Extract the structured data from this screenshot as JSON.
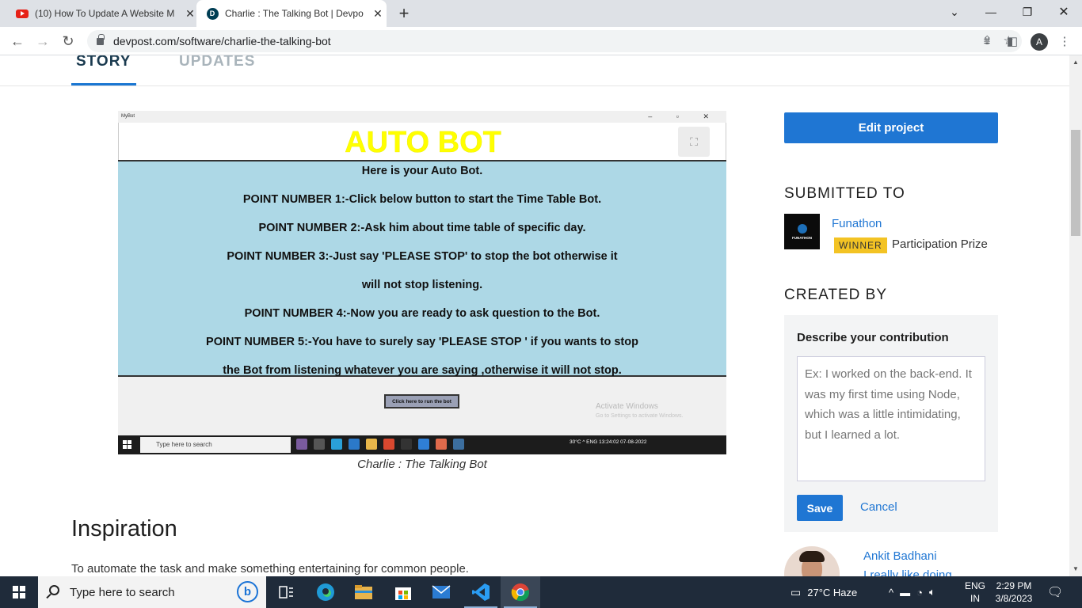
{
  "browser": {
    "tabs": [
      {
        "title": "(10) How To Update A Website M",
        "favicon": "youtube-icon"
      },
      {
        "title": "Charlie : The Talking Bot | Devpo",
        "favicon": "devpost-icon"
      }
    ],
    "url": "devpost.com/software/charlie-the-talking-bot",
    "profile_initial": "A"
  },
  "story_tabs": {
    "story": "STORY",
    "updates": "UPDATES"
  },
  "gallery": {
    "app_window_title": "MyBot",
    "app_heading": "AUTO BOT",
    "lines": [
      "Here is your Auto Bot.",
      "POINT NUMBER 1:-Click below button to start the Time Table Bot.",
      "POINT NUMBER 2:-Ask him about time table of specific day.",
      "POINT NUMBER 3:-Just say 'PLEASE STOP' to stop the bot otherwise it",
      "will not stop listening.",
      "POINT NUMBER 4:-Now you are ready to ask question to the Bot.",
      "POINT NUMBER 5:-You have to surely say 'PLEASE STOP ' if you wants to stop",
      "the Bot from listening whatever you are saying ,otherwise it will not stop."
    ],
    "run_button": "Click here to run the bot",
    "activate_title": "Activate Windows",
    "activate_sub": "Go to Settings to activate Windows.",
    "inner_search": "Type here to search",
    "inner_tray": "30°C  ^  ENG  13:24:02  07-08-2022",
    "caption": "Charlie : The Talking Bot"
  },
  "content": {
    "heading": "Inspiration",
    "paragraph": "To automate the task and make something entertaining for common people."
  },
  "sidebar": {
    "edit_button": "Edit project",
    "submitted_to": "SUBMITTED TO",
    "hackathon": {
      "name": "Funathon",
      "logo_text": "FUNATHON",
      "badge": "WINNER",
      "prize": "Participation Prize"
    },
    "created_by": "CREATED BY",
    "contribution": {
      "label": "Describe your contribution",
      "placeholder": "Ex: I worked on the back-end. It was my first time using Node, which was a little intimidating, but I learned a lot.",
      "save": "Save",
      "cancel": "Cancel"
    },
    "member": {
      "name": "Ankit Badhani",
      "bio": "I really like doing"
    }
  },
  "taskbar": {
    "search_placeholder": "Type here to search",
    "weather": "27°C  Haze",
    "lang": "ENG",
    "region": "IN",
    "time": "2:29 PM",
    "date": "3/8/2023"
  }
}
